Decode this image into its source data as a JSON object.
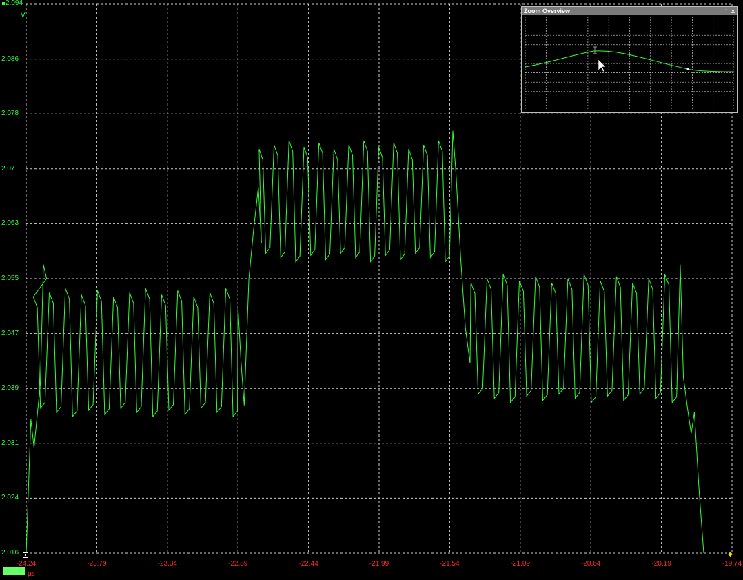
{
  "y_axis": {
    "unit": "V",
    "labels": [
      "2.094",
      "2.086",
      "2.078",
      "2.07",
      "2.063",
      "2.055",
      "2.047",
      "2.039",
      "2.031",
      "2.024",
      "2.016"
    ]
  },
  "x_axis": {
    "unit": "µs",
    "labels": [
      "-24.24",
      "-23.79",
      "-23.34",
      "-22.89",
      "-22.44",
      "-21.99",
      "-21.54",
      "-21.09",
      "-20.64",
      "-20.19",
      "-19.74"
    ]
  },
  "scale_marker": {
    "value": ""
  },
  "zoom_overview": {
    "title": "Zoom Overview",
    "minimize": "-",
    "close": "x"
  },
  "colors": {
    "trace": "#33ff33",
    "grid": "#cfcfcf",
    "x_labels": "#ff2a2a",
    "y_labels": "#33ff33",
    "panel_border": "#bfbfbf"
  },
  "chart_data": {
    "type": "line",
    "title": "",
    "xlabel": "µs",
    "ylabel": "V",
    "xlim": [
      -24.24,
      -19.74
    ],
    "ylim": [
      2.016,
      2.094
    ],
    "grid": true,
    "segments": [
      {
        "x_start": -24.2,
        "x_end": -22.87,
        "high": 2.053,
        "low": 2.036,
        "cycles": 13
      },
      {
        "x_start": -22.76,
        "x_end": -21.52,
        "high": 2.074,
        "low": 2.058,
        "cycles": 13
      },
      {
        "x_start": -21.41,
        "x_end": -20.07,
        "high": 2.055,
        "low": 2.038,
        "cycles": 13
      }
    ],
    "series": [
      {
        "values_edges": [
          {
            "x": -24.24,
            "y": 2.016
          },
          {
            "x": -24.21,
            "y": 2.035
          },
          {
            "x": -24.19,
            "y": 2.031
          },
          {
            "x": -24.15,
            "y": 2.04
          },
          {
            "x": -24.13,
            "y": 2.057
          },
          {
            "x": -24.11,
            "y": 2.055
          },
          {
            "x": -22.89,
            "y": 2.051
          },
          {
            "x": -22.87,
            "y": 2.043
          },
          {
            "x": -22.85,
            "y": 2.037
          },
          {
            "x": -22.82,
            "y": 2.055
          },
          {
            "x": -22.79,
            "y": 2.062
          },
          {
            "x": -22.76,
            "y": 2.068
          },
          {
            "x": -22.74,
            "y": 2.06
          },
          {
            "x": -21.52,
            "y": 2.076
          },
          {
            "x": -21.5,
            "y": 2.07
          },
          {
            "x": -21.47,
            "y": 2.058
          },
          {
            "x": -21.44,
            "y": 2.048
          },
          {
            "x": -21.41,
            "y": 2.043
          },
          {
            "x": -20.07,
            "y": 2.057
          },
          {
            "x": -20.05,
            "y": 2.041
          },
          {
            "x": -20.02,
            "y": 2.036
          },
          {
            "x": -20.0,
            "y": 2.033
          },
          {
            "x": -19.98,
            "y": 2.036
          },
          {
            "x": -19.95,
            "y": 2.025
          },
          {
            "x": -19.92,
            "y": 2.016
          }
        ]
      }
    ]
  }
}
